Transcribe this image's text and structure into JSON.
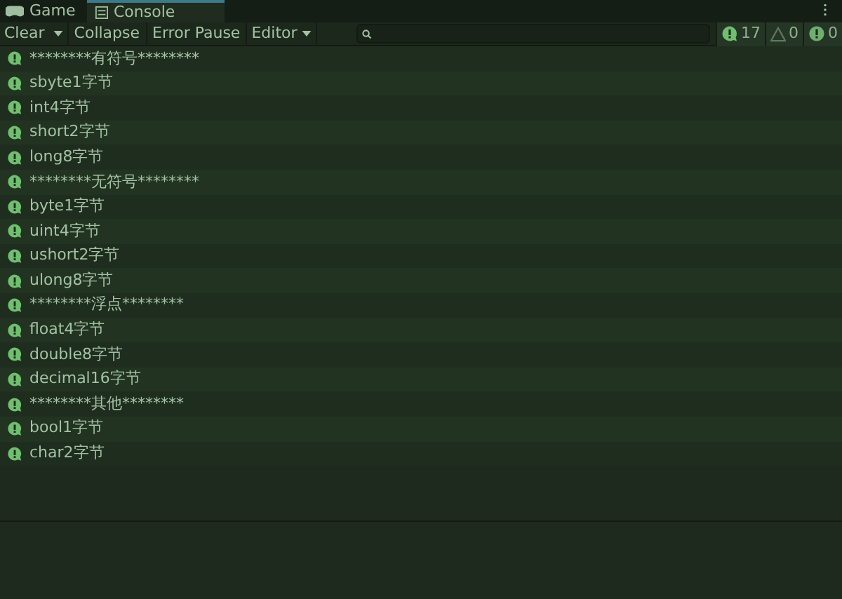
{
  "tabs": [
    {
      "label": "Game",
      "kind": "game",
      "selected": false
    },
    {
      "label": "Console",
      "kind": "console",
      "selected": true
    }
  ],
  "toolbar": {
    "clear": "Clear",
    "collapse": "Collapse",
    "error_pause": "Error Pause",
    "editor": "Editor"
  },
  "counts": [
    {
      "kind": "log",
      "count": "17"
    },
    {
      "kind": "warning",
      "count": "0"
    },
    {
      "kind": "error",
      "count": "0"
    }
  ],
  "logs": [
    {
      "message": "********有符号********"
    },
    {
      "message": "sbyte1字节"
    },
    {
      "message": "int4字节"
    },
    {
      "message": "short2字节"
    },
    {
      "message": "long8字节"
    },
    {
      "message": "********无符号********"
    },
    {
      "message": "byte1字节"
    },
    {
      "message": "uint4字节"
    },
    {
      "message": "ushort2字节"
    },
    {
      "message": "ulong8字节"
    },
    {
      "message": "********浮点********"
    },
    {
      "message": "float4字节"
    },
    {
      "message": "double8字节"
    },
    {
      "message": "decimal16字节"
    },
    {
      "message": "********其他********"
    },
    {
      "message": "bool1字节"
    },
    {
      "message": "char2字节"
    }
  ]
}
